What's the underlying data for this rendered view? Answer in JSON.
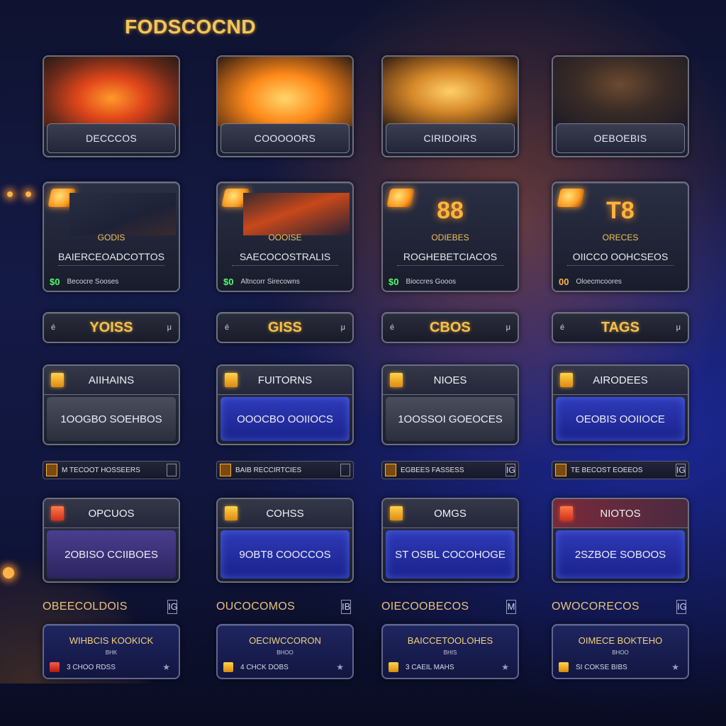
{
  "title": "FODSCOCND",
  "row1": [
    {
      "label": "DECCCOS",
      "image": "orange-crates"
    },
    {
      "label": "COOOOORS",
      "image": "glowing-coin-box"
    },
    {
      "label": "CIRIDOIRS",
      "image": "golden-blocks"
    },
    {
      "label": "OEBOEBIS",
      "image": "wooden-chest"
    }
  ],
  "row2": [
    {
      "big": "",
      "sub": "GODIS",
      "name": "BAIERCEOADCOTTOS",
      "count": "$0",
      "foot": "Becocre Sooses"
    },
    {
      "big": "",
      "sub": "OOOISE",
      "name": "SAECOCOSTRALIS",
      "count": "$0",
      "foot": "Altncorr Sirecowns"
    },
    {
      "big": "88",
      "sub": "ODIEBES",
      "name": "ROGHEBETCIACOS",
      "count": "$0",
      "foot": "Bioccres Gooos"
    },
    {
      "big": "T8",
      "sub": "ORECES",
      "name": "OIICCO OOHCSEOS",
      "count": "00",
      "foot": "Oloecmcoores"
    }
  ],
  "tags": [
    {
      "left": "é",
      "text": "YOISS",
      "right": "μ"
    },
    {
      "left": "é",
      "text": "GISS",
      "right": "μ"
    },
    {
      "left": "é",
      "text": "CBOS",
      "right": "μ"
    },
    {
      "left": "é",
      "text": "TAGS",
      "right": "μ"
    }
  ],
  "sections1": [
    {
      "title": "AIIHAINS",
      "body": "1OOGBO SOEHBOS",
      "style": "gray",
      "icon": "yellow"
    },
    {
      "title": "FUITORNS",
      "body": "OOOCBO OOIIOCS",
      "style": "blue",
      "icon": "yellow"
    },
    {
      "title": "NIOES",
      "body": "1OOSSOI GOEOCES",
      "style": "gray",
      "icon": "yellow"
    },
    {
      "title": "AIRODEES",
      "body": "OEOBIS OOIIOCE",
      "style": "blue",
      "icon": "yellow"
    }
  ],
  "strips1": [
    {
      "label": "M TECOOT HOSSEERS",
      "end": ""
    },
    {
      "label": "BAIB RECCIRTCIES",
      "end": ""
    },
    {
      "label": "EGBEES FASSESS",
      "end": "IG"
    },
    {
      "label": "TE BECOST EOEEOS",
      "end": "IG"
    }
  ],
  "sections2": [
    {
      "title": "OPCUOS",
      "body": "2OBISO CCIIBOES",
      "style": "purple",
      "icon": "red"
    },
    {
      "title": "COHSS",
      "body": "9OBT8 COOCCOS",
      "style": "blue",
      "icon": "yellow"
    },
    {
      "title": "OMGS",
      "body": "ST OSBL COCOHOGE",
      "style": "blue",
      "icon": "yellow"
    },
    {
      "title": "NIOTOS",
      "body": "2SZBOE SOBOOS",
      "style": "blue",
      "icon": "red"
    }
  ],
  "strips2": [
    {
      "label": "OBEECOLDOIS",
      "end": "IG"
    },
    {
      "label": "OUCOCOMOS",
      "end": "IB"
    },
    {
      "label": "OIECOOBECOS",
      "end": "M"
    },
    {
      "label": "OWOCORECOS",
      "end": "IG"
    }
  ],
  "bottom": [
    {
      "title": "WIHBCIS KOOKICK",
      "sub": "BHK",
      "foot": "3 CHOO RDSS",
      "icon": "red"
    },
    {
      "title": "OECIWCCORON",
      "sub": "BHOO",
      "foot": "4 CHCK DOBS",
      "icon": "yellow"
    },
    {
      "title": "BAICCETOOLOHES",
      "sub": "BHIS",
      "foot": "3 CAEIL MAHS",
      "icon": "yellow"
    },
    {
      "title": "OIMECE BOKTEHO",
      "sub": "BHOO",
      "foot": "SI COKSE BIBS",
      "icon": "yellow"
    }
  ]
}
